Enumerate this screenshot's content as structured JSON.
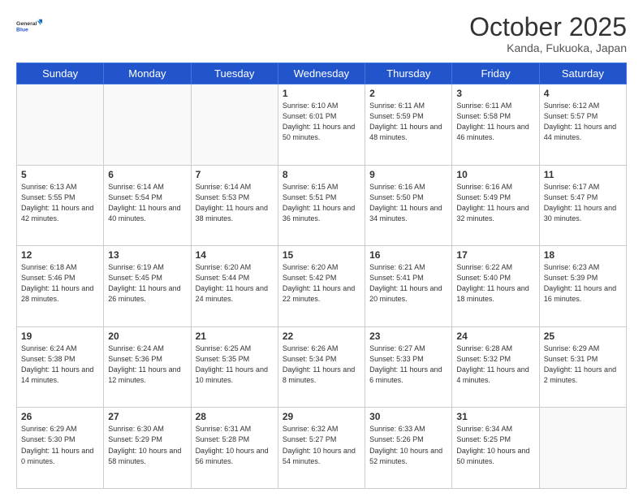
{
  "header": {
    "logo_line1": "General",
    "logo_line2": "Blue",
    "month": "October 2025",
    "location": "Kanda, Fukuoka, Japan"
  },
  "weekdays": [
    "Sunday",
    "Monday",
    "Tuesday",
    "Wednesday",
    "Thursday",
    "Friday",
    "Saturday"
  ],
  "weeks": [
    [
      {
        "day": "",
        "sunrise": "",
        "sunset": "",
        "daylight": ""
      },
      {
        "day": "",
        "sunrise": "",
        "sunset": "",
        "daylight": ""
      },
      {
        "day": "",
        "sunrise": "",
        "sunset": "",
        "daylight": ""
      },
      {
        "day": "1",
        "sunrise": "Sunrise: 6:10 AM",
        "sunset": "Sunset: 6:01 PM",
        "daylight": "Daylight: 11 hours and 50 minutes."
      },
      {
        "day": "2",
        "sunrise": "Sunrise: 6:11 AM",
        "sunset": "Sunset: 5:59 PM",
        "daylight": "Daylight: 11 hours and 48 minutes."
      },
      {
        "day": "3",
        "sunrise": "Sunrise: 6:11 AM",
        "sunset": "Sunset: 5:58 PM",
        "daylight": "Daylight: 11 hours and 46 minutes."
      },
      {
        "day": "4",
        "sunrise": "Sunrise: 6:12 AM",
        "sunset": "Sunset: 5:57 PM",
        "daylight": "Daylight: 11 hours and 44 minutes."
      }
    ],
    [
      {
        "day": "5",
        "sunrise": "Sunrise: 6:13 AM",
        "sunset": "Sunset: 5:55 PM",
        "daylight": "Daylight: 11 hours and 42 minutes."
      },
      {
        "day": "6",
        "sunrise": "Sunrise: 6:14 AM",
        "sunset": "Sunset: 5:54 PM",
        "daylight": "Daylight: 11 hours and 40 minutes."
      },
      {
        "day": "7",
        "sunrise": "Sunrise: 6:14 AM",
        "sunset": "Sunset: 5:53 PM",
        "daylight": "Daylight: 11 hours and 38 minutes."
      },
      {
        "day": "8",
        "sunrise": "Sunrise: 6:15 AM",
        "sunset": "Sunset: 5:51 PM",
        "daylight": "Daylight: 11 hours and 36 minutes."
      },
      {
        "day": "9",
        "sunrise": "Sunrise: 6:16 AM",
        "sunset": "Sunset: 5:50 PM",
        "daylight": "Daylight: 11 hours and 34 minutes."
      },
      {
        "day": "10",
        "sunrise": "Sunrise: 6:16 AM",
        "sunset": "Sunset: 5:49 PM",
        "daylight": "Daylight: 11 hours and 32 minutes."
      },
      {
        "day": "11",
        "sunrise": "Sunrise: 6:17 AM",
        "sunset": "Sunset: 5:47 PM",
        "daylight": "Daylight: 11 hours and 30 minutes."
      }
    ],
    [
      {
        "day": "12",
        "sunrise": "Sunrise: 6:18 AM",
        "sunset": "Sunset: 5:46 PM",
        "daylight": "Daylight: 11 hours and 28 minutes."
      },
      {
        "day": "13",
        "sunrise": "Sunrise: 6:19 AM",
        "sunset": "Sunset: 5:45 PM",
        "daylight": "Daylight: 11 hours and 26 minutes."
      },
      {
        "day": "14",
        "sunrise": "Sunrise: 6:20 AM",
        "sunset": "Sunset: 5:44 PM",
        "daylight": "Daylight: 11 hours and 24 minutes."
      },
      {
        "day": "15",
        "sunrise": "Sunrise: 6:20 AM",
        "sunset": "Sunset: 5:42 PM",
        "daylight": "Daylight: 11 hours and 22 minutes."
      },
      {
        "day": "16",
        "sunrise": "Sunrise: 6:21 AM",
        "sunset": "Sunset: 5:41 PM",
        "daylight": "Daylight: 11 hours and 20 minutes."
      },
      {
        "day": "17",
        "sunrise": "Sunrise: 6:22 AM",
        "sunset": "Sunset: 5:40 PM",
        "daylight": "Daylight: 11 hours and 18 minutes."
      },
      {
        "day": "18",
        "sunrise": "Sunrise: 6:23 AM",
        "sunset": "Sunset: 5:39 PM",
        "daylight": "Daylight: 11 hours and 16 minutes."
      }
    ],
    [
      {
        "day": "19",
        "sunrise": "Sunrise: 6:24 AM",
        "sunset": "Sunset: 5:38 PM",
        "daylight": "Daylight: 11 hours and 14 minutes."
      },
      {
        "day": "20",
        "sunrise": "Sunrise: 6:24 AM",
        "sunset": "Sunset: 5:36 PM",
        "daylight": "Daylight: 11 hours and 12 minutes."
      },
      {
        "day": "21",
        "sunrise": "Sunrise: 6:25 AM",
        "sunset": "Sunset: 5:35 PM",
        "daylight": "Daylight: 11 hours and 10 minutes."
      },
      {
        "day": "22",
        "sunrise": "Sunrise: 6:26 AM",
        "sunset": "Sunset: 5:34 PM",
        "daylight": "Daylight: 11 hours and 8 minutes."
      },
      {
        "day": "23",
        "sunrise": "Sunrise: 6:27 AM",
        "sunset": "Sunset: 5:33 PM",
        "daylight": "Daylight: 11 hours and 6 minutes."
      },
      {
        "day": "24",
        "sunrise": "Sunrise: 6:28 AM",
        "sunset": "Sunset: 5:32 PM",
        "daylight": "Daylight: 11 hours and 4 minutes."
      },
      {
        "day": "25",
        "sunrise": "Sunrise: 6:29 AM",
        "sunset": "Sunset: 5:31 PM",
        "daylight": "Daylight: 11 hours and 2 minutes."
      }
    ],
    [
      {
        "day": "26",
        "sunrise": "Sunrise: 6:29 AM",
        "sunset": "Sunset: 5:30 PM",
        "daylight": "Daylight: 11 hours and 0 minutes."
      },
      {
        "day": "27",
        "sunrise": "Sunrise: 6:30 AM",
        "sunset": "Sunset: 5:29 PM",
        "daylight": "Daylight: 10 hours and 58 minutes."
      },
      {
        "day": "28",
        "sunrise": "Sunrise: 6:31 AM",
        "sunset": "Sunset: 5:28 PM",
        "daylight": "Daylight: 10 hours and 56 minutes."
      },
      {
        "day": "29",
        "sunrise": "Sunrise: 6:32 AM",
        "sunset": "Sunset: 5:27 PM",
        "daylight": "Daylight: 10 hours and 54 minutes."
      },
      {
        "day": "30",
        "sunrise": "Sunrise: 6:33 AM",
        "sunset": "Sunset: 5:26 PM",
        "daylight": "Daylight: 10 hours and 52 minutes."
      },
      {
        "day": "31",
        "sunrise": "Sunrise: 6:34 AM",
        "sunset": "Sunset: 5:25 PM",
        "daylight": "Daylight: 10 hours and 50 minutes."
      },
      {
        "day": "",
        "sunrise": "",
        "sunset": "",
        "daylight": ""
      }
    ]
  ]
}
